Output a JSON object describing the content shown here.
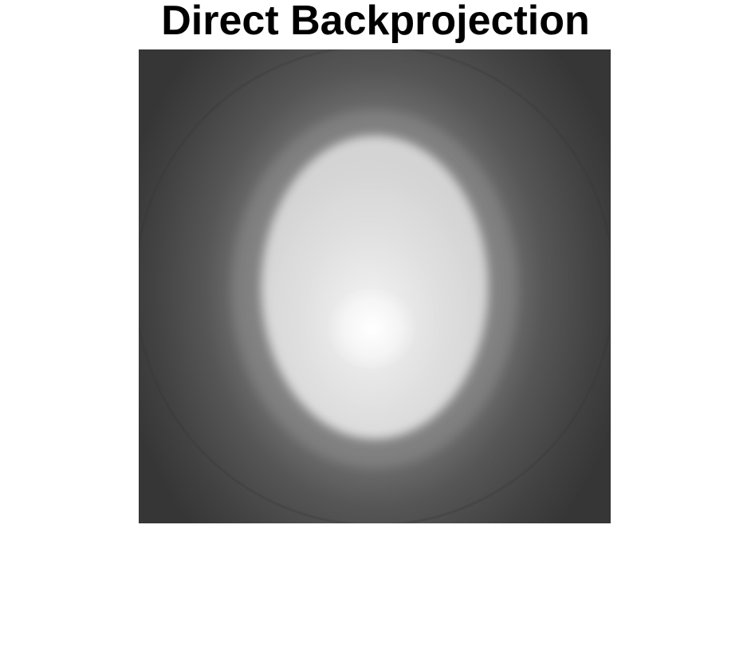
{
  "figure": {
    "title": "Direct Backprojection"
  },
  "image": {
    "colormap": "gray",
    "content": "backprojected reconstruction of an ellipse phantom"
  }
}
